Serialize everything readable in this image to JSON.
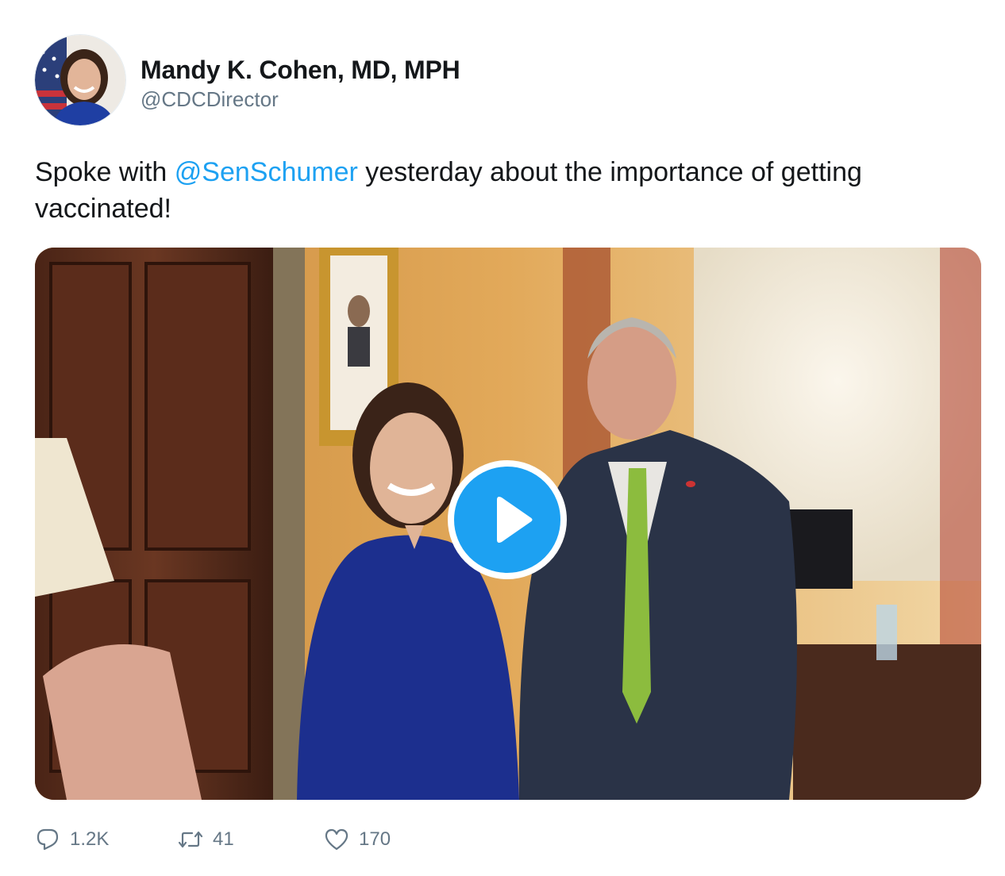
{
  "author": {
    "display_name": "Mandy K. Cohen, MD, MPH",
    "handle": "@CDCDirector",
    "avatar_icon": "profile-photo"
  },
  "tweet": {
    "text_before": "Spoke with ",
    "mention": "@SenSchumer",
    "text_after": " yesterday about the importance of getting vaccinated!"
  },
  "media": {
    "type": "video",
    "play_icon": "play-icon"
  },
  "actions": {
    "reply": {
      "icon": "reply-icon",
      "count": "1.2K"
    },
    "retweet": {
      "icon": "retweet-icon",
      "count": "41"
    },
    "like": {
      "icon": "heart-icon",
      "count": "170"
    }
  },
  "colors": {
    "accent": "#1da1f2",
    "text_primary": "#14171a",
    "text_secondary": "#657786"
  }
}
